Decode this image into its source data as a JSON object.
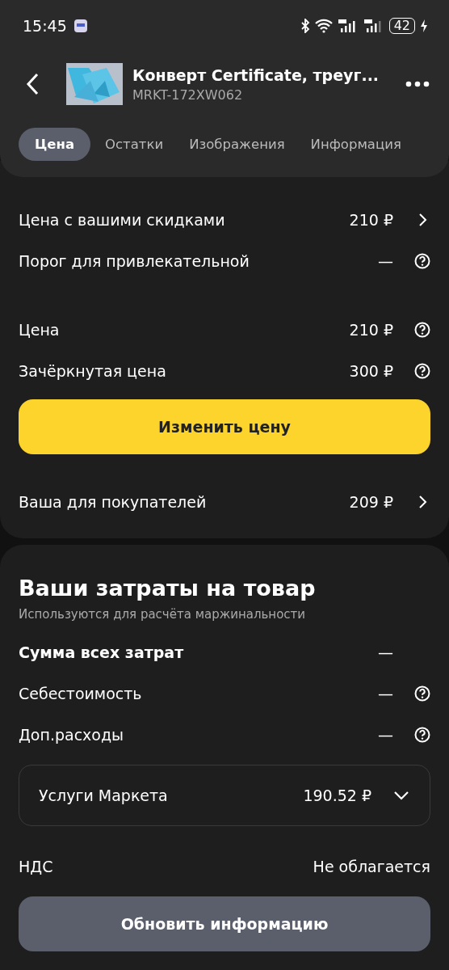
{
  "status_bar": {
    "time": "15:45",
    "battery": "42"
  },
  "header": {
    "title": "Конверт Certificate, треуг...",
    "sku": "MRKT-172XW062",
    "tabs": [
      {
        "label": "Цена",
        "selected": true
      },
      {
        "label": "Остатки",
        "selected": false
      },
      {
        "label": "Изображения",
        "selected": false
      },
      {
        "label": "Информация",
        "selected": false
      }
    ]
  },
  "price": {
    "groups": [
      [
        {
          "label": "Цена с вашими скидками",
          "value": "210 ₽",
          "kind": "chevron"
        },
        {
          "label": "Порог для привлекательной",
          "value": "—",
          "kind": "help"
        }
      ],
      [
        {
          "label": "Цена",
          "value": "210 ₽",
          "kind": "help"
        },
        {
          "label": "Зачёркнутая цена",
          "value": "300 ₽",
          "kind": "help"
        }
      ]
    ],
    "button": "Изменить цену",
    "after": [
      {
        "label": "Ваша для покупателей",
        "value": "209 ₽",
        "kind": "chevron"
      }
    ]
  },
  "costs": {
    "title": "Ваши затраты на товар",
    "subtitle": "Используются для расчёта маржинальности",
    "rows": [
      {
        "label": "Сумма всех затрат",
        "value": "—",
        "kind": "none",
        "bold": true
      },
      {
        "label": "Себестоимость",
        "value": "—",
        "kind": "help",
        "bold": false
      },
      {
        "label": "Доп.расходы",
        "value": "—",
        "kind": "help",
        "bold": false
      }
    ],
    "services": {
      "label": "Услуги Маркета",
      "value": "190.52 ₽",
      "expanded": false
    },
    "vat": {
      "label": "НДС",
      "value": "Не облагается"
    },
    "button": "Обновить информацию"
  }
}
